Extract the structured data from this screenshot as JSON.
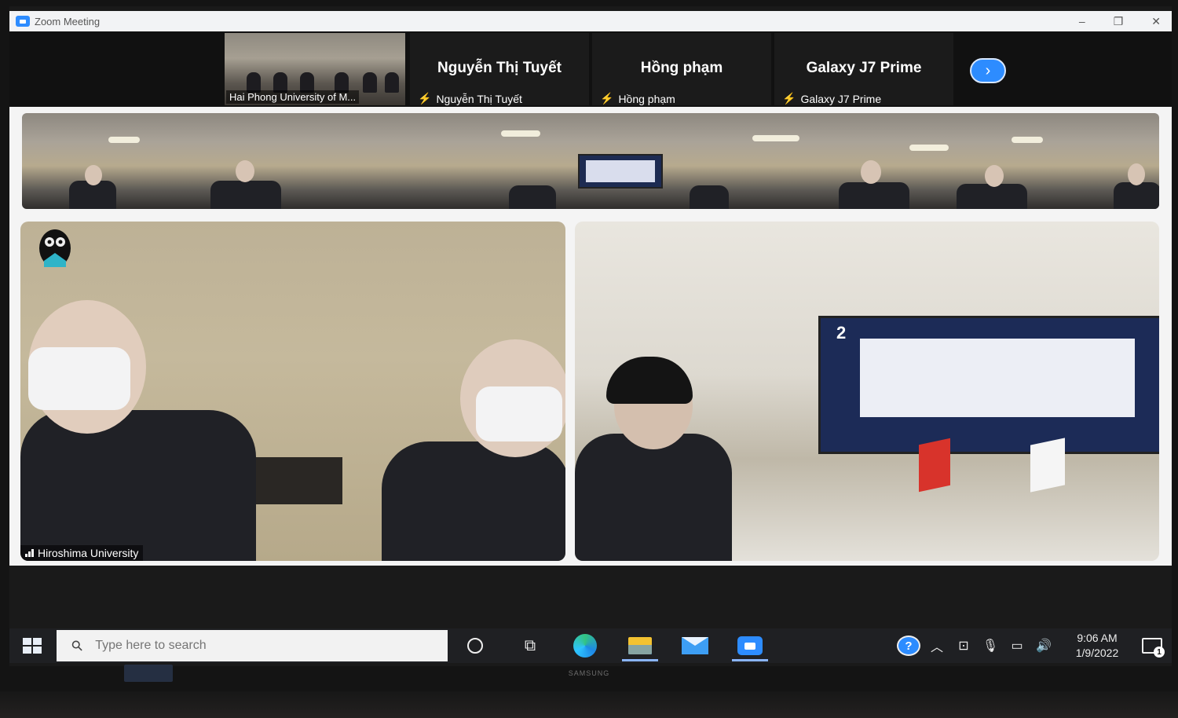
{
  "window": {
    "title": "Zoom Meeting",
    "controls": [
      "–",
      "❐",
      "✕"
    ]
  },
  "strip": {
    "thumbnails": [
      {
        "type": "video",
        "label": "Hai Phong University of M..."
      },
      {
        "type": "name",
        "display_name": "Nguyễn Thị Tuyết",
        "label": "Nguyễn Thị Tuyết",
        "muted": true
      },
      {
        "type": "name",
        "display_name": "Hồng phạm",
        "label": "Hồng phạm",
        "muted": true
      },
      {
        "type": "name",
        "display_name": "Galaxy J7 Prime",
        "label": "Galaxy J7 Prime",
        "muted": true
      }
    ],
    "next_icon": "chevron-right-icon",
    "next_glyph": "›"
  },
  "gallery": {
    "left_tile_label": "Hiroshima University",
    "tv_screen_number": "2"
  },
  "taskbar": {
    "search_placeholder": "Type here to search",
    "search_glyph": "⚲",
    "taskview_glyph": "⧉",
    "tray_up_glyph": "︿",
    "tray_meet_glyph": "⊡",
    "tray_mic_glyph": "🎙",
    "tray_network_glyph": "▭",
    "tray_volume_glyph": "🔊",
    "help_glyph": "?",
    "time": "9:06 AM",
    "date": "1/9/2022",
    "notification_count": "1"
  },
  "monitor": {
    "brand": "SAMSUNG"
  },
  "colors": {
    "zoom_blue": "#2d8cff",
    "muted_red": "#e02828",
    "taskbar": "#1f2023",
    "titlebar": "#f2f3f5"
  }
}
